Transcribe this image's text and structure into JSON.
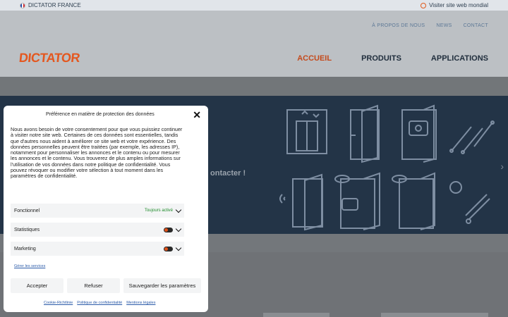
{
  "topbar": {
    "site_label": "DICTATOR FRANCE",
    "visit_label": "Visiter site web mondial"
  },
  "header": {
    "logo_text": "DICTATOR",
    "secondary_nav": [
      "À PROPOS DE NOUS",
      "NEWS",
      "CONTACT"
    ],
    "main_nav": [
      {
        "label": "ACCUEIL",
        "active": true
      },
      {
        "label": "PRODUITS",
        "active": false
      },
      {
        "label": "APPLICATIONS",
        "active": false
      }
    ]
  },
  "hero": {
    "text_fragment": "ontacter !",
    "next_arrow": "›"
  },
  "consent": {
    "title": "Préférence en matière de protection des données",
    "close": "✕",
    "body": "Nous avons besoin de votre consentement pour que vous puissiez continuer à visiter notre site web. Certaines de ces données sont essentielles, tandis que d'autres nous aident à améliorer ce site web et votre expérience. Des données personnelles peuvent être traitées (par exemple, les adresses IP), notamment pour personnaliser les annonces et le contenu ou pour mesurer les annonces et le contenu. Vous trouverez de plus amples informations sur l'utilisation de vos données dans notre politique de confidentialité. Vous pouvez révoquer ou modifier votre sélection à tout moment dans les paramètres de confidentialité.",
    "categories": [
      {
        "name": "Fonctionnel",
        "status": "Toujours activé"
      },
      {
        "name": "Statistiques",
        "status": ""
      },
      {
        "name": "Marketing",
        "status": ""
      }
    ],
    "manage_link": "Gérer les services",
    "buttons": {
      "accept": "Accepter",
      "refuse": "Refuser",
      "save": "Sauvegarder les paramètres"
    },
    "links": [
      "Cookie-Richtlinie",
      "Politique de confidentialité",
      "Mentions légales"
    ]
  },
  "colors": {
    "brand_orange": "#e4571f",
    "active_nav": "#c44a1c",
    "hero_bg": "#233447",
    "always_on_green": "#1e8c2a"
  }
}
